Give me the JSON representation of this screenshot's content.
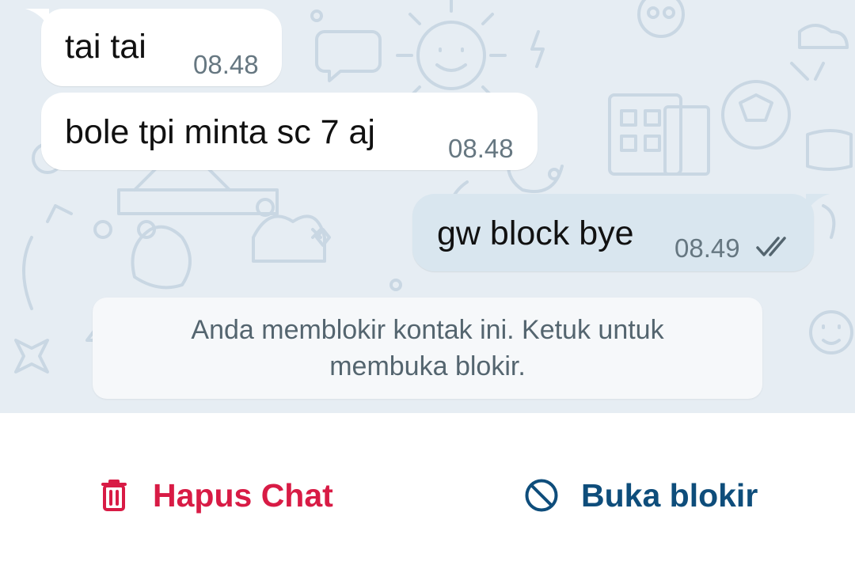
{
  "messages": [
    {
      "direction": "in",
      "text": "tai tai",
      "time": "08.48"
    },
    {
      "direction": "in",
      "text": "bole tpi minta sc 7 aj",
      "time": "08.48"
    },
    {
      "direction": "out",
      "text": "gw block bye",
      "time": "08.49",
      "status": "double-check-icon"
    }
  ],
  "notice": {
    "text": "Anda memblokir kontak ini. Ketuk untuk membuka blokir."
  },
  "actions": {
    "delete_label": "Hapus Chat",
    "unblock_label": "Buka blokir"
  },
  "colors": {
    "chat_background": "#e6edf3",
    "incoming_bubble": "#ffffff",
    "outgoing_bubble": "#d9e6ef",
    "delete_red": "#d81b45",
    "unblock_blue": "#0e4d7b",
    "timestamp": "#667781"
  },
  "icons": {
    "delete": "trash-icon",
    "unblock": "block-icon"
  }
}
